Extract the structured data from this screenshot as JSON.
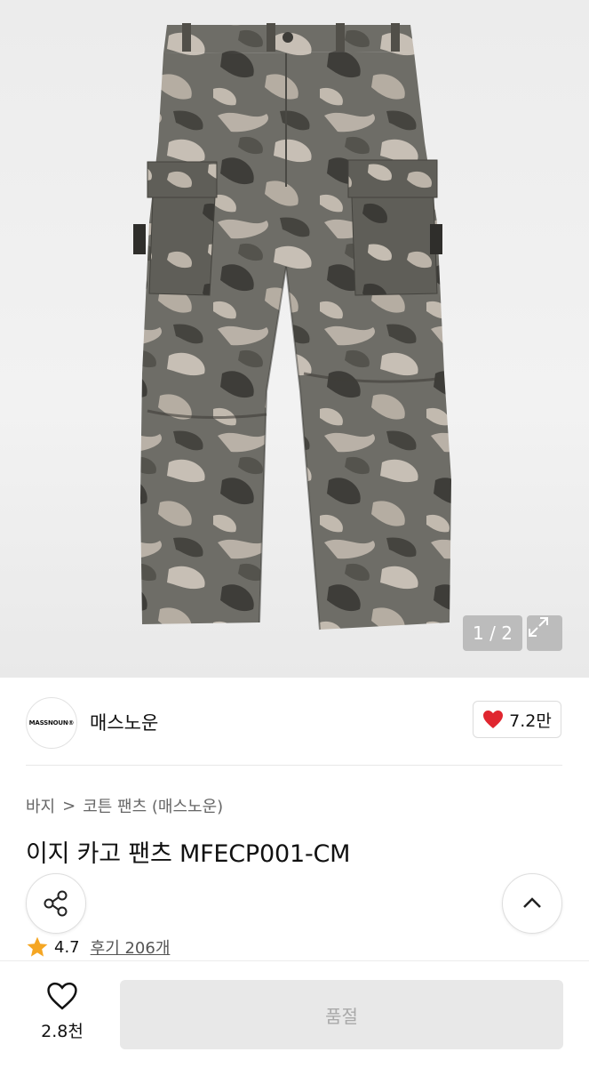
{
  "gallery": {
    "counter": "1 / 2"
  },
  "brand": {
    "logo_text": "MASSNOUN®",
    "name": "매스노운",
    "likes": "7.2만"
  },
  "breadcrumb": {
    "category": "바지",
    "separator": ">",
    "subcategory": "코튼 팬츠 (매스노운)"
  },
  "product": {
    "title": "이지 카고 팬츠 MFECP001-CM",
    "rating": "4.7",
    "reviews": "후기 206개"
  },
  "bottom": {
    "wish_count": "2.8천",
    "buy_label": "품절"
  },
  "colors": {
    "heart": "#e0262f",
    "star": "#f5a623"
  }
}
